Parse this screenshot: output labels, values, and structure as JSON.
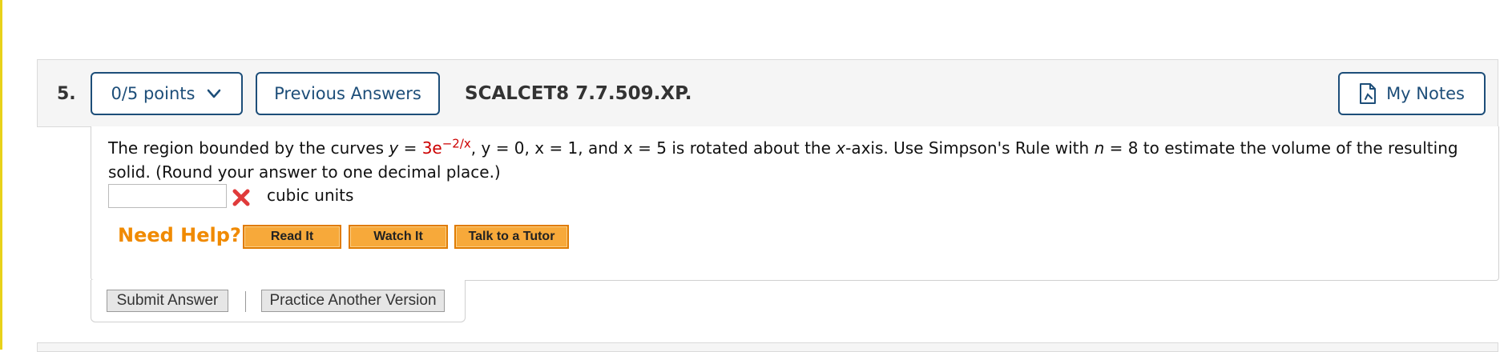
{
  "question": {
    "number": "5.",
    "points_label": "0/5 points",
    "previous_answers_label": "Previous Answers",
    "code": "SCALCET8 7.7.509.XP.",
    "my_notes_label": "My Notes"
  },
  "problem": {
    "text_1": "The region bounded by the curves ",
    "y_eq": "y = ",
    "coef": "3e",
    "exponent": "−2/x",
    "text_2": ", y = 0, x = 1, and x = 5  is rotated about the ",
    "x_axis": "x",
    "text_3": "-axis. Use Simpson's Rule with ",
    "n": "n",
    "text_4": " = 8 to estimate the volume of the resulting solid. (Round your answer to one decimal place.)",
    "answer_value": "",
    "units": "cubic units"
  },
  "help": {
    "label": "Need Help?",
    "read_it": "Read It",
    "watch_it": "Watch It",
    "talk_to_tutor": "Talk to a Tutor"
  },
  "actions": {
    "submit": "Submit Answer",
    "practice": "Practice Another Version"
  },
  "colors": {
    "accent": "#1d4e79",
    "help_orange": "#f08a00",
    "incorrect_red": "#e03b3b",
    "left_bar": "#e8d21a"
  },
  "icons": {
    "points_dropdown": "chevron-down-icon",
    "notes": "notes-icon",
    "incorrect": "close-icon"
  }
}
